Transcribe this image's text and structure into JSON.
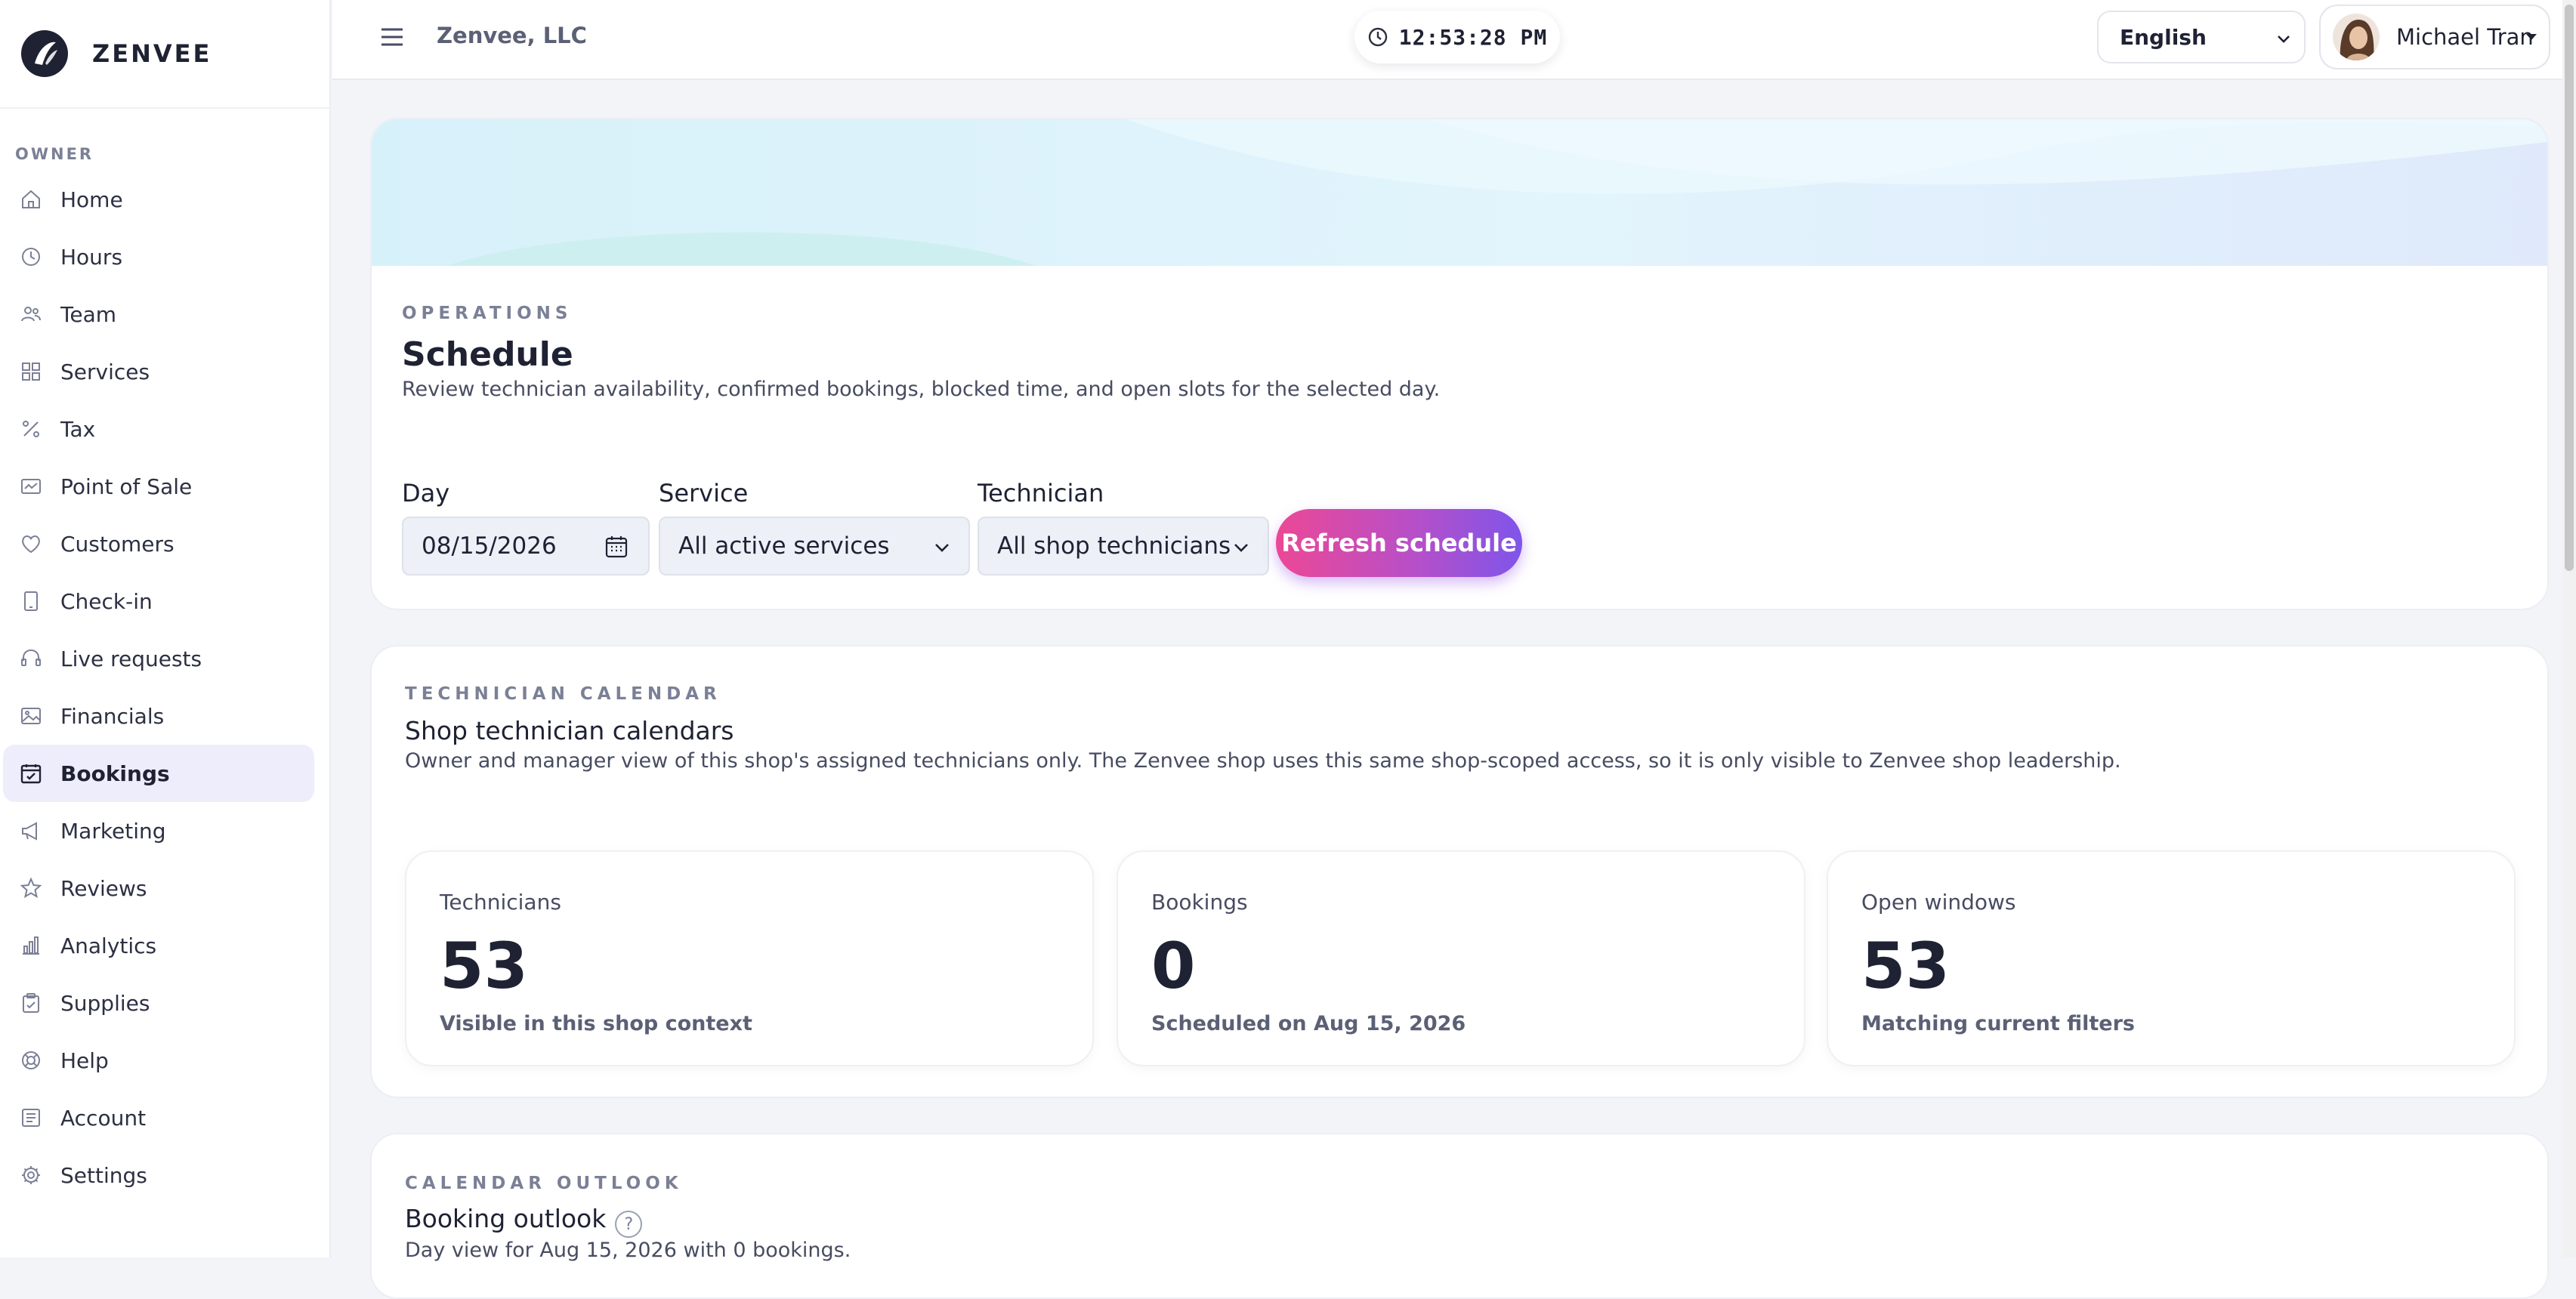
{
  "brand": {
    "name": "ZENVEE"
  },
  "sidebar": {
    "section_label": "OWNER",
    "items": [
      {
        "label": "Home",
        "icon": "home-icon"
      },
      {
        "label": "Hours",
        "icon": "clock-icon"
      },
      {
        "label": "Team",
        "icon": "users-icon"
      },
      {
        "label": "Services",
        "icon": "grid-icon"
      },
      {
        "label": "Tax",
        "icon": "percent-icon"
      },
      {
        "label": "Point of Sale",
        "icon": "pos-icon"
      },
      {
        "label": "Customers",
        "icon": "heart-icon"
      },
      {
        "label": "Check-in",
        "icon": "tablet-icon"
      },
      {
        "label": "Live requests",
        "icon": "headset-icon"
      },
      {
        "label": "Financials",
        "icon": "image-icon"
      },
      {
        "label": "Bookings",
        "icon": "calendar-check-icon",
        "active": true
      },
      {
        "label": "Marketing",
        "icon": "megaphone-icon"
      },
      {
        "label": "Reviews",
        "icon": "star-icon"
      },
      {
        "label": "Analytics",
        "icon": "bar-chart-icon"
      },
      {
        "label": "Supplies",
        "icon": "clipboard-icon"
      },
      {
        "label": "Help",
        "icon": "lifebuoy-icon"
      },
      {
        "label": "Account",
        "icon": "ledger-icon"
      },
      {
        "label": "Settings",
        "icon": "gear-icon"
      }
    ]
  },
  "topbar": {
    "company": "Zenvee, LLC",
    "clock": "12:53:28 PM",
    "language": "English",
    "user_name": "Michael Tran"
  },
  "schedule": {
    "eyebrow": "OPERATIONS",
    "title": "Schedule",
    "description": "Review technician availability, confirmed bookings, blocked time, and open slots for the selected day.",
    "day_label": "Day",
    "day_value": "08/15/2026",
    "service_label": "Service",
    "service_value": "All active services",
    "technician_label": "Technician",
    "technician_value": "All shop technicians",
    "refresh_label": "Refresh schedule"
  },
  "calendar": {
    "eyebrow": "TECHNICIAN CALENDAR",
    "title": "Shop technician calendars",
    "description": "Owner and manager view of this shop's assigned technicians only. The Zenvee shop uses this same shop-scoped access, so it is only visible to Zenvee shop leadership.",
    "stats": [
      {
        "label": "Technicians",
        "value": "53",
        "sub": "Visible in this shop context"
      },
      {
        "label": "Bookings",
        "value": "0",
        "sub": "Scheduled on Aug 15, 2026"
      },
      {
        "label": "Open windows",
        "value": "53",
        "sub": "Matching current filters"
      }
    ]
  },
  "outlook": {
    "eyebrow": "CALENDAR OUTLOOK",
    "title": "Booking outlook",
    "help": "?",
    "description": "Day view for Aug 15, 2026 with 0 bookings."
  },
  "colors": {
    "accent_start": "#ec4895",
    "accent_end": "#7f55ea",
    "active_nav_bg": "#eeedfb"
  }
}
